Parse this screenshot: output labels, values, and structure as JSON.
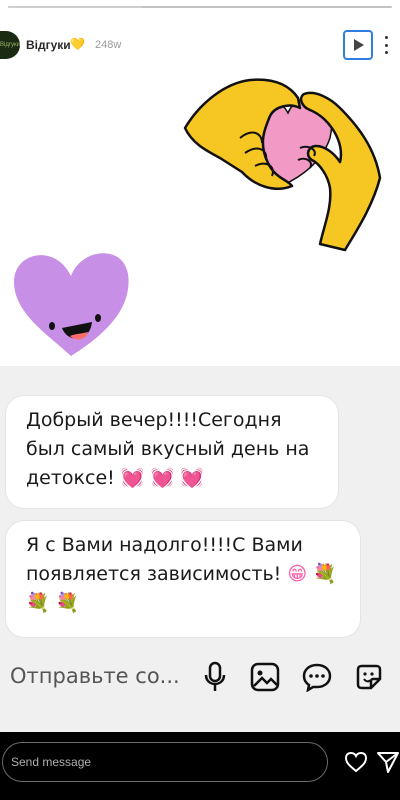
{
  "story": {
    "progress": 0.35,
    "account": {
      "username": "Відгуки",
      "badge": "yellow-heart",
      "time": "248w",
      "avatar_text": "Відгуки"
    },
    "controls": {
      "play_icon": "play-icon",
      "more_icon": "more-icon"
    }
  },
  "messages": [
    {
      "text": "Добрый вечер!!!!Сегодня был самый вкусный день на детоксе!",
      "emoji": "💓 💓 💓"
    },
    {
      "text": "Я с Вами надолго!!!!С Вами появляется зависимость!",
      "emoji": "😁 💐 💐 💐"
    }
  ],
  "composer": {
    "placeholder": "Отправьте со...",
    "icons": [
      "mic-icon",
      "gallery-icon",
      "chat-icon",
      "sticker-icon"
    ]
  },
  "bottom_bar": {
    "send_placeholder": "Send message",
    "icons": [
      "heart-icon",
      "send-icon"
    ]
  },
  "colors": {
    "heart_purple": "#c78fe6",
    "hands_yellow": "#f6c623",
    "heart_pink": "#f29ac6",
    "play_border": "#2f7de1"
  }
}
